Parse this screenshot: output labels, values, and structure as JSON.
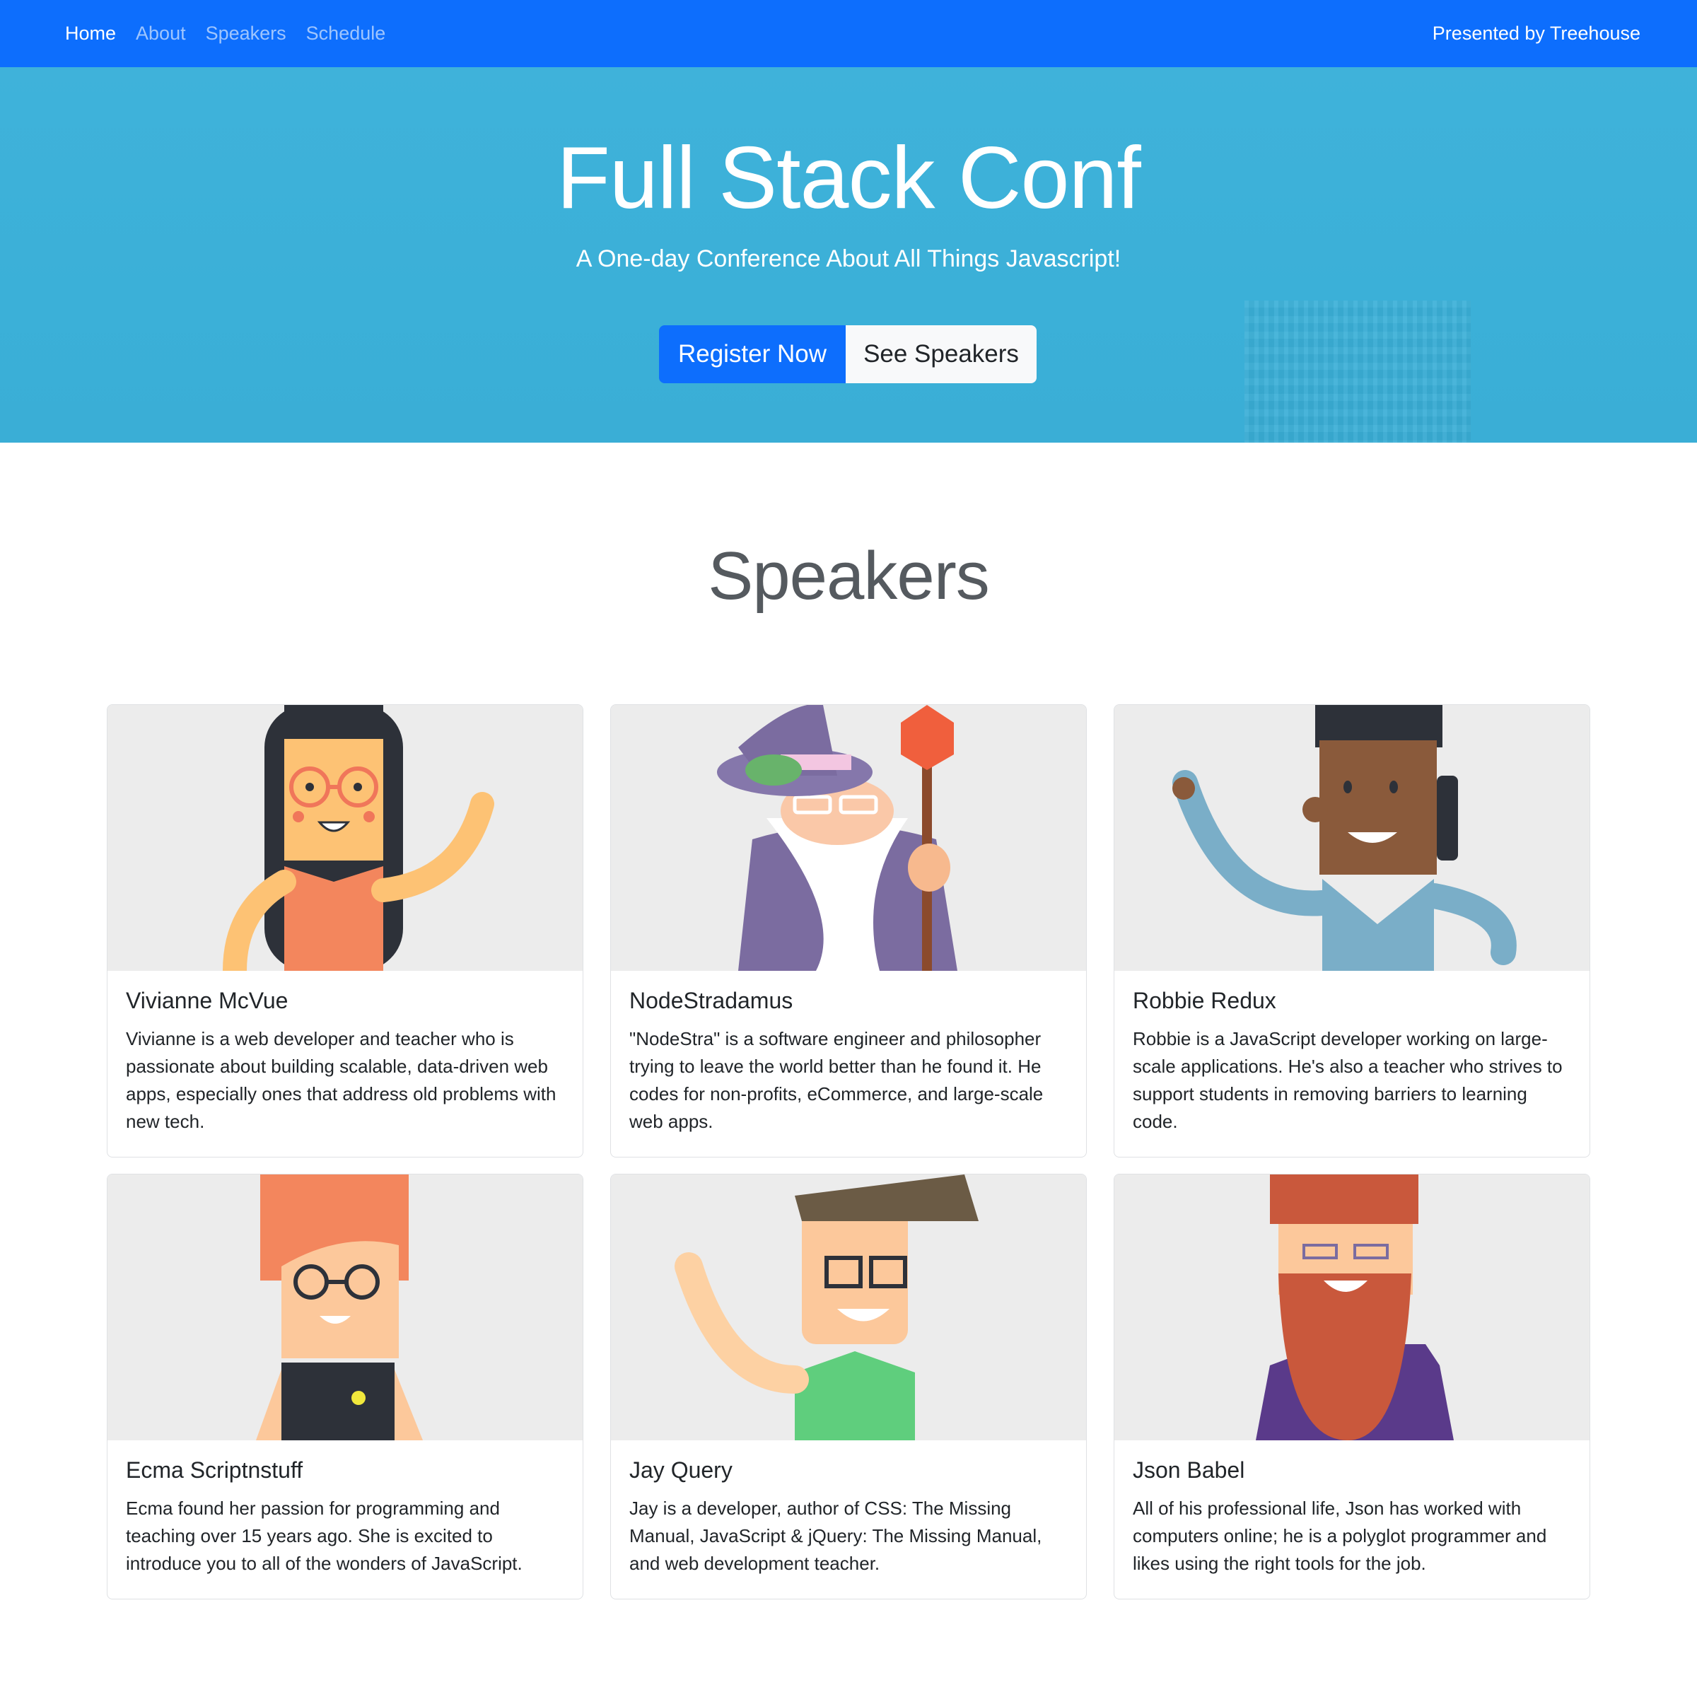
{
  "nav": {
    "links": [
      {
        "label": "Home",
        "active": true
      },
      {
        "label": "About",
        "active": false
      },
      {
        "label": "Speakers",
        "active": false
      },
      {
        "label": "Schedule",
        "active": false
      }
    ],
    "brand": "Presented by Treehouse"
  },
  "hero": {
    "title": "Full Stack Conf",
    "subtitle": "A One-day Conference About All Things Javascript!",
    "register_label": "Register Now",
    "speakers_label": "See Speakers"
  },
  "speakers": {
    "heading": "Speakers",
    "items": [
      {
        "name": "Vivianne McVue",
        "bio": "Vivianne is a web developer and teacher who is passionate about building scalable, data-driven web apps, especially ones that address old problems with new tech.",
        "avatar": "woman-glasses-waving-avatar"
      },
      {
        "name": "NodeStradamus",
        "bio": "\"NodeStra\" is a software engineer and philosopher trying to leave the world better than he found it. He codes for non-profits, eCommerce, and large-scale web apps.",
        "avatar": "wizard-avatar"
      },
      {
        "name": "Robbie Redux",
        "bio": "Robbie is a JavaScript developer working on large-scale applications. He's also a teacher who strives to support students in removing barriers to learning code.",
        "avatar": "man-phone-waving-avatar"
      },
      {
        "name": "Ecma Scriptnstuff",
        "bio": "Ecma found her passion for programming and teaching over 15 years ago. She is excited to introduce you to all of the wonders of JavaScript.",
        "avatar": "woman-red-hair-glasses-avatar"
      },
      {
        "name": "Jay Query",
        "bio": "Jay is a developer, author of CSS: The Missing Manual, JavaScript & jQuery: The Missing Manual, and web development teacher.",
        "avatar": "man-glasses-waving-avatar"
      },
      {
        "name": "Json Babel",
        "bio": "All of his professional life, Json has worked with computers online; he is a polyglot programmer and likes using the right tools for the job.",
        "avatar": "bearded-man-avatar"
      }
    ]
  },
  "colors": {
    "navbar": "#0d6efd",
    "hero": "#3bb0d8",
    "primary_button": "#0d6efd",
    "card_image_bg": "#ececec"
  }
}
